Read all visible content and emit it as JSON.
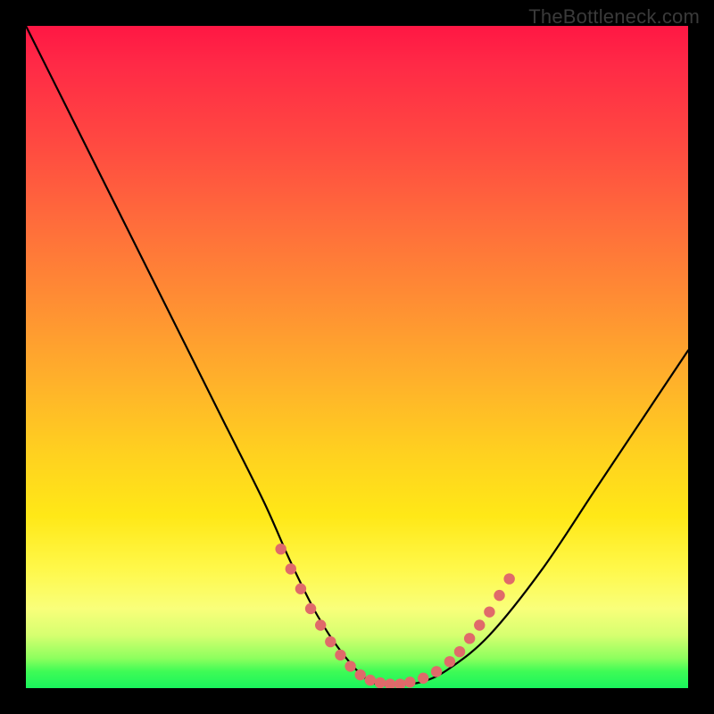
{
  "watermark": "TheBottleneck.com",
  "chart_data": {
    "type": "line",
    "title": "",
    "xlabel": "",
    "ylabel": "",
    "xlim": [
      0,
      100
    ],
    "ylim": [
      0,
      100
    ],
    "series": [
      {
        "name": "bottleneck-curve",
        "x": [
          0,
          6,
          12,
          18,
          24,
          30,
          36,
          40,
          44,
          48,
          52,
          56,
          60,
          64,
          70,
          78,
          86,
          94,
          100
        ],
        "y": [
          100,
          88,
          76,
          64,
          52,
          40,
          28,
          19,
          11,
          5,
          1,
          0.5,
          1,
          3,
          8,
          18,
          30,
          42,
          51
        ]
      }
    ],
    "markers": {
      "name": "highlight-points",
      "color": "#e06a6a",
      "points": [
        {
          "x": 38.5,
          "y": 21
        },
        {
          "x": 40,
          "y": 18
        },
        {
          "x": 41.5,
          "y": 15
        },
        {
          "x": 43,
          "y": 12
        },
        {
          "x": 44.5,
          "y": 9.5
        },
        {
          "x": 46,
          "y": 7
        },
        {
          "x": 47.5,
          "y": 5
        },
        {
          "x": 49,
          "y": 3.3
        },
        {
          "x": 50.5,
          "y": 2.0
        },
        {
          "x": 52,
          "y": 1.2
        },
        {
          "x": 53.5,
          "y": 0.8
        },
        {
          "x": 55,
          "y": 0.6
        },
        {
          "x": 56.5,
          "y": 0.6
        },
        {
          "x": 58,
          "y": 0.9
        },
        {
          "x": 60,
          "y": 1.5
        },
        {
          "x": 62,
          "y": 2.5
        },
        {
          "x": 64,
          "y": 4.0
        },
        {
          "x": 65.5,
          "y": 5.5
        },
        {
          "x": 67,
          "y": 7.5
        },
        {
          "x": 68.5,
          "y": 9.5
        },
        {
          "x": 70,
          "y": 11.5
        },
        {
          "x": 71.5,
          "y": 14
        },
        {
          "x": 73,
          "y": 16.5
        }
      ]
    },
    "gradient_stops": [
      {
        "pos": 0,
        "color": "#ff1744"
      },
      {
        "pos": 50,
        "color": "#ff9b30"
      },
      {
        "pos": 80,
        "color": "#fff030"
      },
      {
        "pos": 100,
        "color": "#19f45c"
      }
    ]
  }
}
